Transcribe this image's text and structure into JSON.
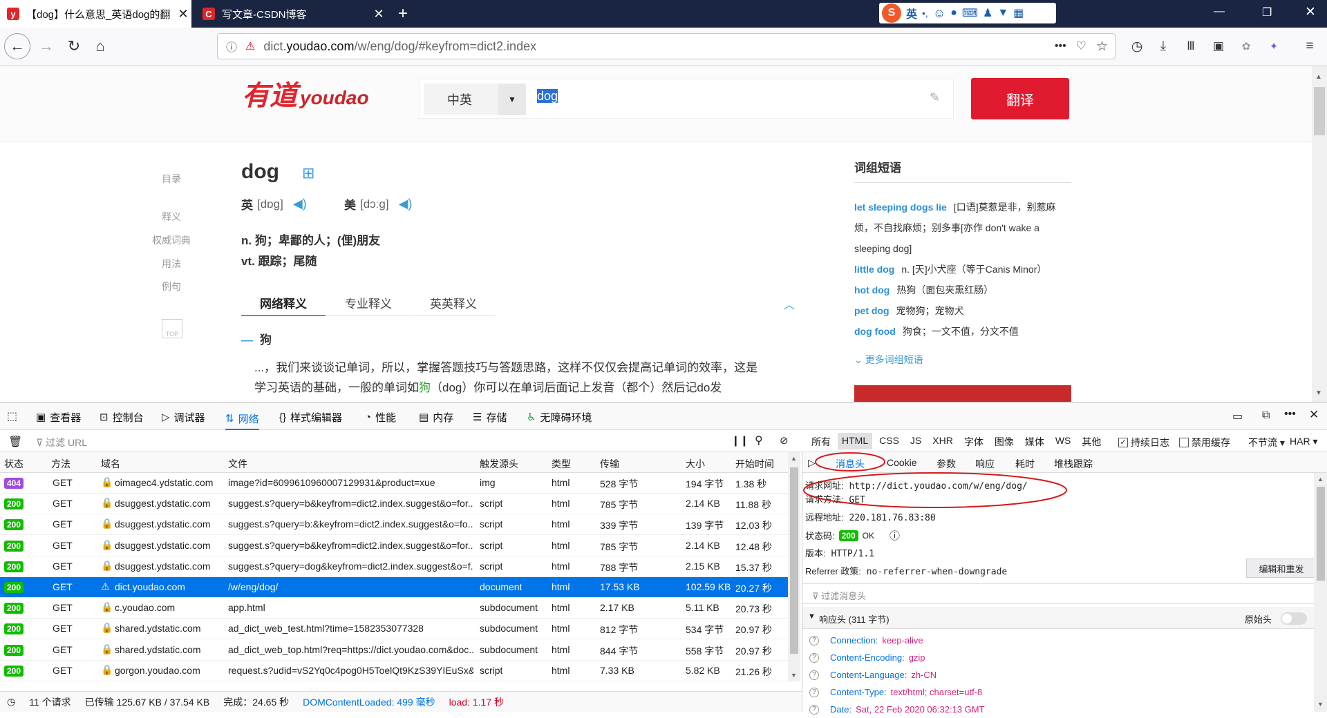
{
  "browser": {
    "tabs": [
      {
        "label": "【dog】什么意思_英语dog的翻",
        "favicon": "y",
        "active": true
      },
      {
        "label": "写文章-CSDN博客",
        "favicon": "C",
        "active": false
      }
    ],
    "ime": {
      "label": "英"
    },
    "url": {
      "prefix": "dict.",
      "domain": "youdao.com",
      "path": "/w/eng/dog/#keyfrom=dict2.index"
    }
  },
  "youdao": {
    "logo_cn": "有道",
    "logo_en": "youdao",
    "search_lang": "中英",
    "search_value": "dog",
    "translate_btn": "翻译",
    "sidenav": [
      "目录",
      "释义",
      "权威词典",
      "用法",
      "例句"
    ],
    "top_label": "TOP",
    "word": "dog",
    "pron_uk_label": "英",
    "pron_uk": "[dɒɡ]",
    "pron_us_label": "美",
    "pron_us": "[dɔːɡ]",
    "defs": [
      "n. 狗；卑鄙的人；(俚)朋友",
      "vt. 跟踪；尾随"
    ],
    "tabs": [
      "网络释义",
      "专业释义",
      "英英释义"
    ],
    "net_head": "狗",
    "net_text1": "...，我们来谈谈记单词，所以，掌握答题技巧与答题思路，这样不仅仅会提高记单词的效率，这是",
    "net_text2_a": "学习英语的基础，一般的单词如",
    "net_text2_b": "狗",
    "net_text2_c": "（dog）你可以在单词后面记上发音（都个）然后记do发",
    "phrase_title": "词组短语",
    "phrases": [
      {
        "en": "let sleeping dogs lie",
        "cn": "[口语]莫惹是非，别惹麻"
      },
      {
        "en": "",
        "cn": "烦，不自找麻烦；别多事[亦作 don't wake a"
      },
      {
        "en": "",
        "cn": "sleeping dog]"
      },
      {
        "en": "little dog",
        "cn": "n. [天]小犬座（等于Canis Minor）"
      },
      {
        "en": "hot dog",
        "cn": "热狗（面包夹熏红肠）"
      },
      {
        "en": "pet dog",
        "cn": "宠物狗；宠物犬"
      },
      {
        "en": "dog food",
        "cn": "狗食；一文不值，分文不值"
      }
    ],
    "more_phrases": "更多词组短语"
  },
  "devtools": {
    "tabs": [
      "查看器",
      "控制台",
      "调试器",
      "网络",
      "样式编辑器",
      "性能",
      "内存",
      "存储",
      "无障碍环境"
    ],
    "filter_placeholder": "过滤 URL",
    "type_filters": [
      "所有",
      "HTML",
      "CSS",
      "JS",
      "XHR",
      "字体",
      "图像",
      "媒体",
      "WS",
      "其他"
    ],
    "persist_log": "持续日志",
    "disable_cache": "禁用缓存",
    "throttle": "不节流 ▾",
    "har": "HAR ▾",
    "columns": [
      "状态",
      "方法",
      "域名",
      "文件",
      "触发源头",
      "类型",
      "传输",
      "大小",
      "开始时间"
    ],
    "requests": [
      {
        "status": "404",
        "method": "GET",
        "domain": "oimagec4.ydstatic.com",
        "file": "image?id=6099610960007129931&product=xue",
        "cause": "img",
        "type": "html",
        "transfer": "528 字节",
        "size": "194 字节",
        "time": "1.38 秒"
      },
      {
        "status": "200",
        "method": "GET",
        "domain": "dsuggest.ydstatic.com",
        "file": "suggest.s?query=b&keyfrom=dict2.index.suggest&o=for...",
        "cause": "script",
        "type": "html",
        "transfer": "785 字节",
        "size": "2.14 KB",
        "time": "11.88 秒"
      },
      {
        "status": "200",
        "method": "GET",
        "domain": "dsuggest.ydstatic.com",
        "file": "suggest.s?query=b:&keyfrom=dict2.index.suggest&o=fo...",
        "cause": "script",
        "type": "html",
        "transfer": "339 字节",
        "size": "139 字节",
        "time": "12.03 秒"
      },
      {
        "status": "200",
        "method": "GET",
        "domain": "dsuggest.ydstatic.com",
        "file": "suggest.s?query=b&keyfrom=dict2.index.suggest&o=for...",
        "cause": "script",
        "type": "html",
        "transfer": "785 字节",
        "size": "2.14 KB",
        "time": "12.48 秒"
      },
      {
        "status": "200",
        "method": "GET",
        "domain": "dsuggest.ydstatic.com",
        "file": "suggest.s?query=dog&keyfrom=dict2.index.suggest&o=f...",
        "cause": "script",
        "type": "html",
        "transfer": "788 字节",
        "size": "2.15 KB",
        "time": "15.37 秒"
      },
      {
        "status": "200",
        "method": "GET",
        "domain": "dict.youdao.com",
        "file": "/w/eng/dog/",
        "cause": "document",
        "type": "html",
        "transfer": "17.53 KB",
        "size": "102.59 KB",
        "time": "20.27 秒"
      },
      {
        "status": "200",
        "method": "GET",
        "domain": "c.youdao.com",
        "file": "app.html",
        "cause": "subdocument",
        "type": "html",
        "transfer": "2.17 KB",
        "size": "5.11 KB",
        "time": "20.73 秒"
      },
      {
        "status": "200",
        "method": "GET",
        "domain": "shared.ydstatic.com",
        "file": "ad_dict_web_test.html?time=1582353077328",
        "cause": "subdocument",
        "type": "html",
        "transfer": "812 字节",
        "size": "534 字节",
        "time": "20.97 秒"
      },
      {
        "status": "200",
        "method": "GET",
        "domain": "shared.ydstatic.com",
        "file": "ad_dict_web_top.html?req=https://dict.youdao.com&doc...",
        "cause": "subdocument",
        "type": "html",
        "transfer": "844 字节",
        "size": "558 字节",
        "time": "20.97 秒"
      },
      {
        "status": "200",
        "method": "GET",
        "domain": "gorgon.youdao.com",
        "file": "request.s?udid=vS2Yq0c4pog0H5ToelQt9KzS39YIEuSx&i...",
        "cause": "script",
        "type": "html",
        "transfer": "7.33 KB",
        "size": "5.82 KB",
        "time": "21.26 秒"
      }
    ],
    "footer": {
      "requests": "11 个请求",
      "transferred": "已传输 125.67 KB / 37.54 KB",
      "finish": "完成：24.65 秒",
      "dcl": "DOMContentLoaded: 499 毫秒",
      "load": "load: 1.17 秒"
    },
    "detail_tabs": [
      "消息头",
      "Cookie",
      "参数",
      "响应",
      "耗时",
      "堆栈跟踪"
    ],
    "req_url_label": "请求网址:",
    "req_url": "http://dict.youdao.com/w/eng/dog/",
    "req_method_label": "请求方法:",
    "req_method": "GET",
    "remote_label": "远程地址:",
    "remote": "220.181.76.83:80",
    "status_label": "状态码:",
    "status_code": "200",
    "status_text": "OK",
    "version_label": "版本:",
    "version": "HTTP/1.1",
    "referrer_label": "Referrer 政策:",
    "referrer": "no-referrer-when-downgrade",
    "edit_resend": "编辑和重发",
    "filter_headers": "过滤消息头",
    "resp_headers": "响应头 (311 字节)",
    "raw_headers": "原始头",
    "headers": [
      {
        "name": "Connection:",
        "value": "keep-alive"
      },
      {
        "name": "Content-Encoding:",
        "value": "gzip"
      },
      {
        "name": "Content-Language:",
        "value": "zh-CN"
      },
      {
        "name": "Content-Type:",
        "value": "text/html; charset=utf-8"
      },
      {
        "name": "Date:",
        "value": "Sat, 22 Feb 2020 06:32:13 GMT"
      }
    ]
  }
}
